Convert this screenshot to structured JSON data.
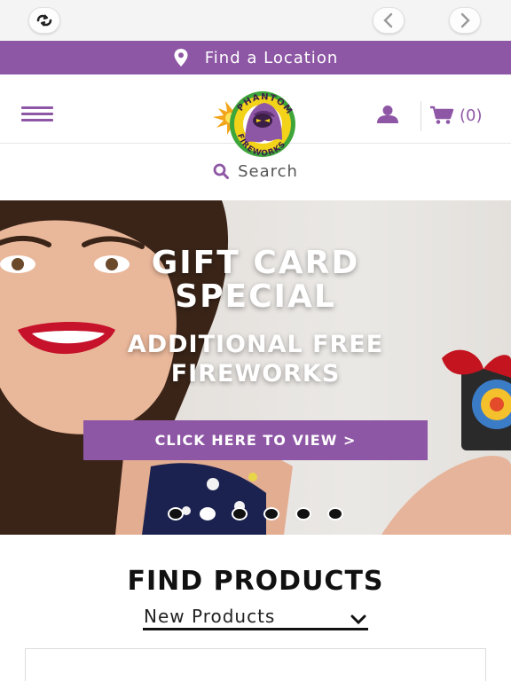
{
  "browser": {
    "reload_icon": "reload-icon",
    "back_icon": "chevron-left-icon",
    "forward_icon": "chevron-right-icon"
  },
  "location_bar": {
    "label": "Find a Location",
    "icon": "map-pin-icon"
  },
  "header": {
    "menu_icon": "hamburger-menu-icon",
    "logo_text_top": "PHANTOM",
    "logo_text_bottom": "FIREWORKS",
    "account_icon": "user-icon",
    "cart_icon": "cart-icon",
    "cart_count": "(0)"
  },
  "search": {
    "label": "Search",
    "icon": "search-icon"
  },
  "hero": {
    "title_line1": "GIFT CARD",
    "title_line2": "SPECIAL",
    "subtitle_line1": "ADDITIONAL FREE",
    "subtitle_line2": "FIREWORKS",
    "cta_label": "CLICK HERE TO VIEW  >",
    "slide_count": 6,
    "active_slide": 2
  },
  "find_products": {
    "title": "FIND PRODUCTS",
    "selected": "New Products"
  },
  "colors": {
    "brand_purple": "#8e57a5",
    "logo_yellow": "#f3d21a",
    "logo_green": "#3ea53a"
  }
}
